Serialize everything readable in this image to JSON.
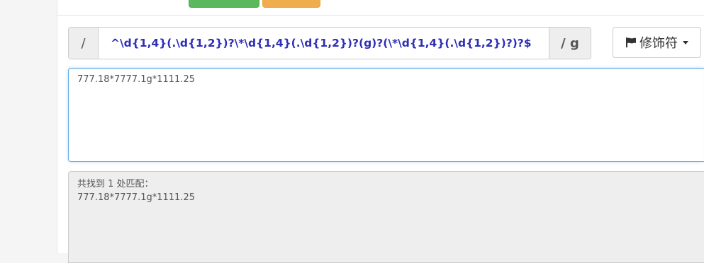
{
  "regex": {
    "open_delimiter": "/",
    "pattern": "^\\d{1,4}(.\\d{1,2})?\\*\\d{1,4}(.\\d{1,2})?(g)?(\\*\\d{1,4}(.\\d{1,2})?)?$",
    "close_delimiter_flags": "/ g"
  },
  "flags_menu": {
    "label": "修饰符",
    "icon": "flag-icon"
  },
  "test_input": {
    "value": "777.18*7777.1g*1111.25"
  },
  "result": {
    "summary": "共找到 1 处匹配：",
    "matches": [
      "777.18*7777.1g*1111.25"
    ]
  },
  "colors": {
    "pattern_text": "#2d2db8",
    "top_button_green": "#5cb85c",
    "top_button_orange": "#f0ad4e",
    "focus_border": "#66afe9"
  }
}
